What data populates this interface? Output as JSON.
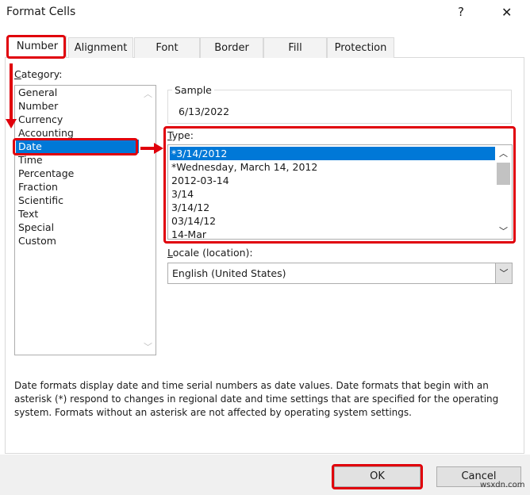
{
  "title": "Format Cells",
  "help": "?",
  "close": "✕",
  "tabs": [
    "Number",
    "Alignment",
    "Font",
    "Border",
    "Fill",
    "Protection"
  ],
  "category": {
    "label_u": "C",
    "label_rest": "ategory:",
    "items": [
      "General",
      "Number",
      "Currency",
      "Accounting",
      "Date",
      "Time",
      "Percentage",
      "Fraction",
      "Scientific",
      "Text",
      "Special",
      "Custom"
    ],
    "selected": "Date"
  },
  "sample": {
    "label": "Sample",
    "value": "6/13/2022"
  },
  "type": {
    "label_u": "T",
    "label_rest": "ype:",
    "items": [
      "*3/14/2012",
      "*Wednesday, March 14, 2012",
      "2012-03-14",
      "3/14",
      "3/14/12",
      "03/14/12",
      "14-Mar"
    ],
    "selected": "*3/14/2012"
  },
  "locale": {
    "label_u": "L",
    "label_rest": "ocale (location):",
    "value": "English (United States)"
  },
  "description": "Date formats display date and time serial numbers as date values.  Date formats that begin with an asterisk (*) respond to changes in regional date and time settings that are specified for the operating system. Formats without an asterisk are not affected by operating system settings.",
  "buttons": {
    "ok": "OK",
    "cancel": "Cancel"
  },
  "watermark": "wsxdn.com",
  "highlight_color": "#e0000b"
}
